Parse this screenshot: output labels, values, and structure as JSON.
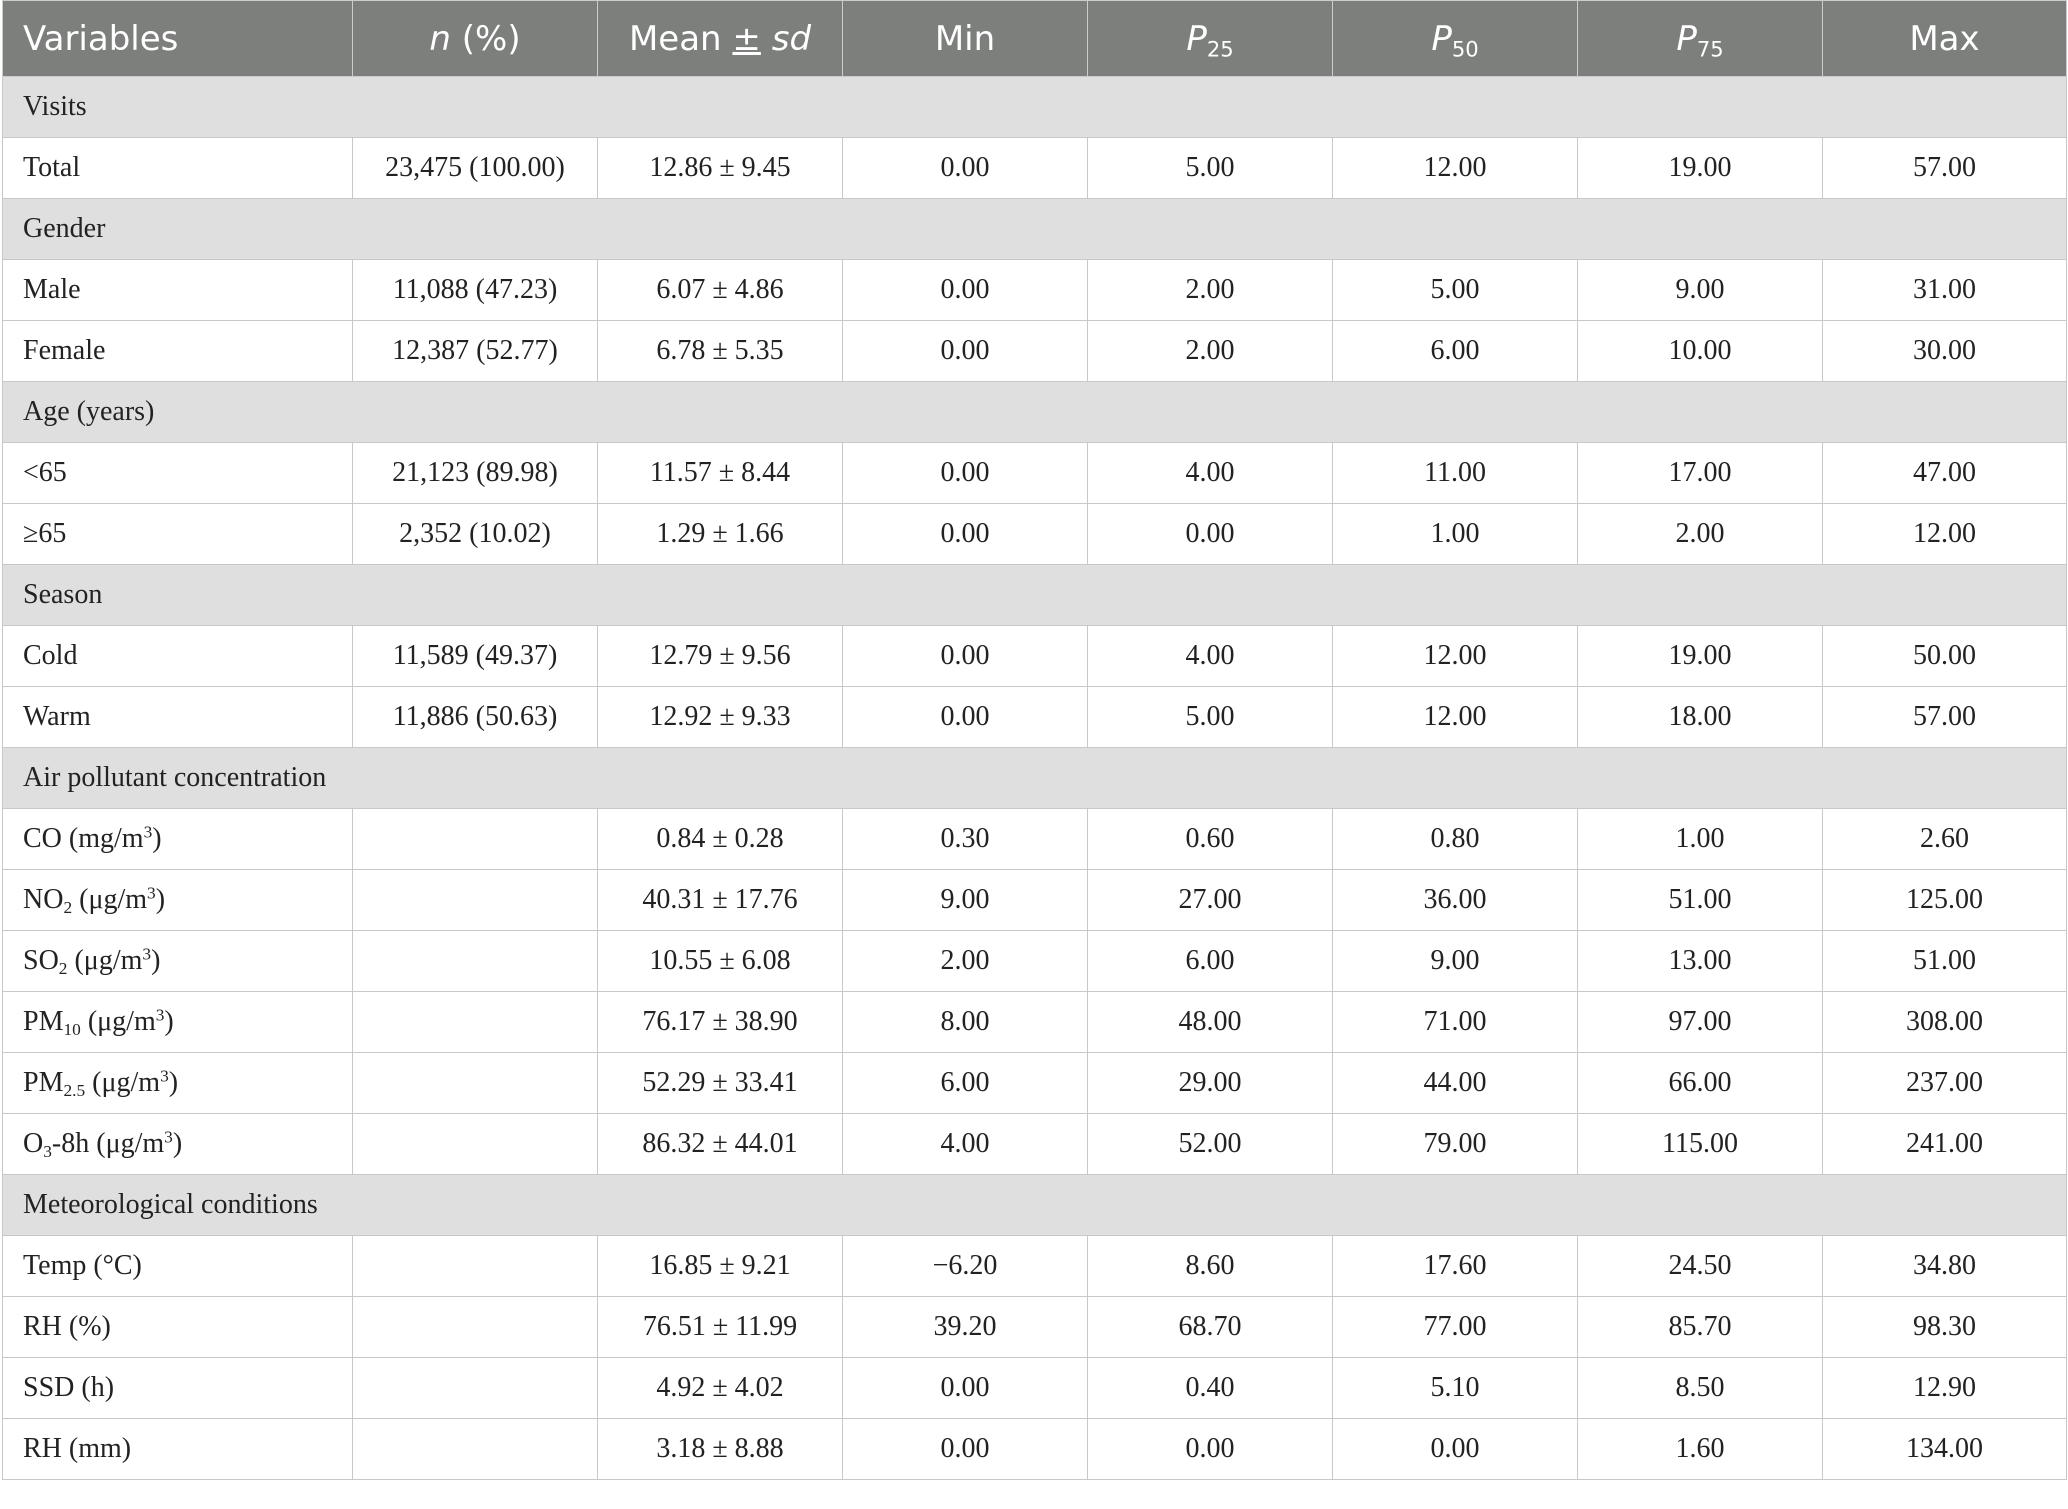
{
  "header": {
    "variables": "Variables",
    "n_italic": "n",
    "n_rest": " (%)",
    "mean_pre": "Mean ",
    "mean_pm": "±",
    "mean_sd": " sd",
    "min": "Min",
    "p": "P",
    "p25_sub": "25",
    "p50_sub": "50",
    "p75_sub": "75",
    "max": "Max"
  },
  "sections": {
    "visits": "Visits",
    "gender": "Gender",
    "age": "Age (years)",
    "season": "Season",
    "air": "Air pollutant concentration",
    "met": "Meteorological conditions"
  },
  "rows": {
    "total": {
      "label": "Total",
      "n": "23,475 (100.00)",
      "mean": "12.86 ± 9.45",
      "min": "0.00",
      "p25": "5.00",
      "p50": "12.00",
      "p75": "19.00",
      "max": "57.00"
    },
    "male": {
      "label": "Male",
      "n": "11,088 (47.23)",
      "mean": "6.07 ± 4.86",
      "min": "0.00",
      "p25": "2.00",
      "p50": "5.00",
      "p75": "9.00",
      "max": "31.00"
    },
    "female": {
      "label": "Female",
      "n": "12,387 (52.77)",
      "mean": "6.78 ± 5.35",
      "min": "0.00",
      "p25": "2.00",
      "p50": "6.00",
      "p75": "10.00",
      "max": "30.00"
    },
    "lt65": {
      "label": "<65",
      "n": "21,123 (89.98)",
      "mean": "11.57 ± 8.44",
      "min": "0.00",
      "p25": "4.00",
      "p50": "11.00",
      "p75": "17.00",
      "max": "47.00"
    },
    "ge65": {
      "label": "≥65",
      "n": "2,352 (10.02)",
      "mean": "1.29 ± 1.66",
      "min": "0.00",
      "p25": "0.00",
      "p50": "1.00",
      "p75": "2.00",
      "max": "12.00"
    },
    "cold": {
      "label": "Cold",
      "n": "11,589 (49.37)",
      "mean": "12.79 ± 9.56",
      "min": "0.00",
      "p25": "4.00",
      "p50": "12.00",
      "p75": "19.00",
      "max": "50.00"
    },
    "warm": {
      "label": "Warm",
      "n": "11,886 (50.63)",
      "mean": "12.92 ± 9.33",
      "min": "0.00",
      "p25": "5.00",
      "p50": "12.00",
      "p75": "18.00",
      "max": "57.00"
    },
    "co": {
      "label_pre": "CO (mg/m",
      "label_sup": "3",
      "label_post": ")",
      "n": "",
      "mean": "0.84 ± 0.28",
      "min": "0.30",
      "p25": "0.60",
      "p50": "0.80",
      "p75": "1.00",
      "max": "2.60"
    },
    "no2": {
      "label_pre": "NO",
      "label_sub": "2",
      "label_mid": " (μg/m",
      "label_sup": "3",
      "label_post": ")",
      "n": "",
      "mean": "40.31 ± 17.76",
      "min": "9.00",
      "p25": "27.00",
      "p50": "36.00",
      "p75": "51.00",
      "max": "125.00"
    },
    "so2": {
      "label_pre": "SO",
      "label_sub": "2",
      "label_mid": " (μg/m",
      "label_sup": "3",
      "label_post": ")",
      "n": "",
      "mean": "10.55 ± 6.08",
      "min": "2.00",
      "p25": "6.00",
      "p50": "9.00",
      "p75": "13.00",
      "max": "51.00"
    },
    "pm10": {
      "label_pre": "PM",
      "label_sub": "10",
      "label_mid": " (μg/m",
      "label_sup": "3",
      "label_post": ")",
      "n": "",
      "mean": "76.17 ± 38.90",
      "min": "8.00",
      "p25": "48.00",
      "p50": "71.00",
      "p75": "97.00",
      "max": "308.00"
    },
    "pm25": {
      "label_pre": "PM",
      "label_sub": "2.5",
      "label_mid": " (μg/m",
      "label_sup": "3",
      "label_post": ")",
      "n": "",
      "mean": "52.29 ± 33.41",
      "min": "6.00",
      "p25": "29.00",
      "p50": "44.00",
      "p75": "66.00",
      "max": "237.00"
    },
    "o3": {
      "label_pre": "O",
      "label_sub": "3",
      "label_mid": "-8h (μg/m",
      "label_sup": "3",
      "label_post": ")",
      "n": "",
      "mean": "86.32 ± 44.01",
      "min": "4.00",
      "p25": "52.00",
      "p50": "79.00",
      "p75": "115.00",
      "max": "241.00"
    },
    "temp": {
      "label": "Temp (°C)",
      "n": "",
      "mean": "16.85 ± 9.21",
      "min": "−6.20",
      "p25": "8.60",
      "p50": "17.60",
      "p75": "24.50",
      "max": "34.80"
    },
    "rh": {
      "label": "RH (%)",
      "n": "",
      "mean": "76.51 ± 11.99",
      "min": "39.20",
      "p25": "68.70",
      "p50": "77.00",
      "p75": "85.70",
      "max": "98.30"
    },
    "ssd": {
      "label": "SSD (h)",
      "n": "",
      "mean": "4.92 ± 4.02",
      "min": "0.00",
      "p25": "0.40",
      "p50": "5.10",
      "p75": "8.50",
      "max": "12.90"
    },
    "rhmm": {
      "label": "RH (mm)",
      "n": "",
      "mean": "3.18 ± 8.88",
      "min": "0.00",
      "p25": "0.00",
      "p50": "0.00",
      "p75": "1.60",
      "max": "134.00"
    }
  }
}
